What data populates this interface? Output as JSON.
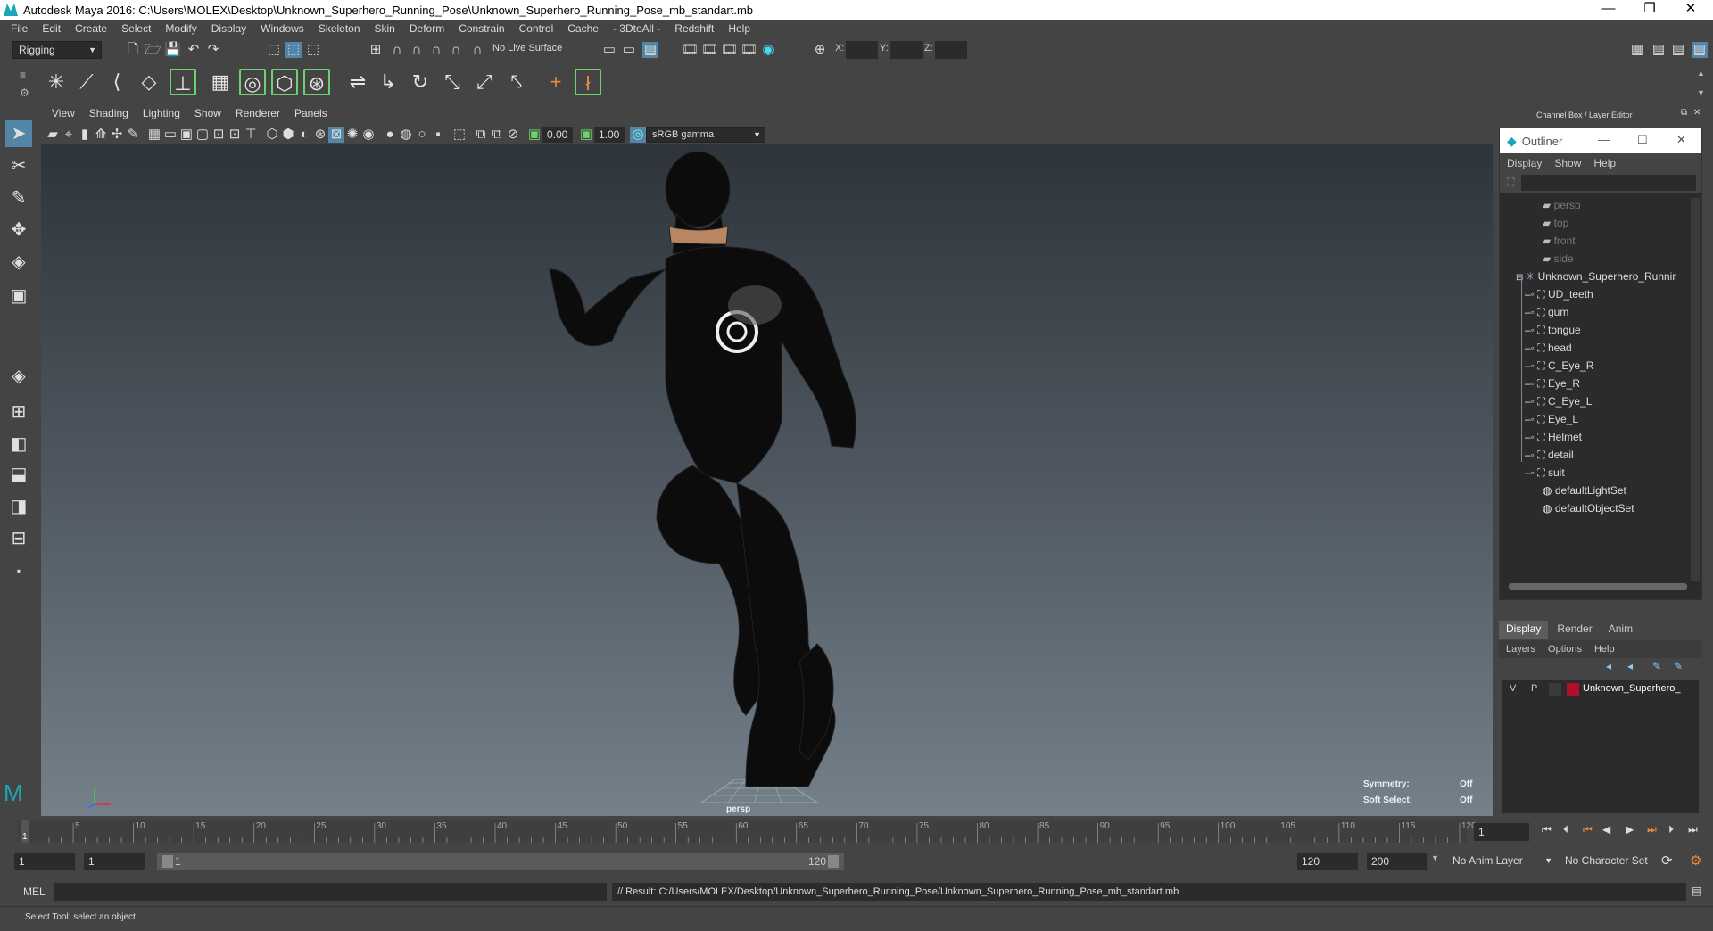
{
  "window": {
    "title": "Autodesk Maya 2016: C:\\Users\\MOLEX\\Desktop\\Unknown_Superhero_Running_Pose\\Unknown_Superhero_Running_Pose_mb_standart.mb"
  },
  "menubar": [
    "File",
    "Edit",
    "Create",
    "Select",
    "Modify",
    "Display",
    "Windows",
    "Skeleton",
    "Skin",
    "Deform",
    "Constrain",
    "Control",
    "Cache",
    "- 3DtoAll -",
    "Redshift",
    "Help"
  ],
  "statusline": {
    "menuset": "Rigging",
    "live_surface": "No Live Surface",
    "x_label": "X:",
    "y_label": "Y:",
    "z_label": "Z:"
  },
  "panel": {
    "menu": [
      "View",
      "Shading",
      "Lighting",
      "Show",
      "Renderer",
      "Panels"
    ],
    "exposure": "0.00",
    "gamma": "1.00",
    "colorspace": "sRGB gamma"
  },
  "viewport": {
    "camera_label": "persp",
    "symmetry_label": "Symmetry:",
    "symmetry_value": "Off",
    "soft_select_label": "Soft Select:",
    "soft_select_value": "Off"
  },
  "right_panel": {
    "header": "Channel Box / Layer Editor"
  },
  "outliner": {
    "title": "Outliner",
    "menu": [
      "Display",
      "Show",
      "Help"
    ],
    "cameras": [
      "persp",
      "top",
      "front",
      "side"
    ],
    "root": "Unknown_Superhero_Runnir",
    "children": [
      "UD_teeth",
      "gum",
      "tongue",
      "head",
      "C_Eye_R",
      "Eye_R",
      "C_Eye_L",
      "Eye_L",
      "Helmet",
      "detail",
      "suit"
    ],
    "sets": [
      "defaultLightSet",
      "defaultObjectSet"
    ]
  },
  "layer_editor": {
    "tabs": [
      "Display",
      "Render",
      "Anim"
    ],
    "menu": [
      "Layers",
      "Options",
      "Help"
    ],
    "layer": {
      "v": "V",
      "p": "P",
      "name": "Unknown_Superhero_",
      "color": "#b0102a"
    }
  },
  "time_slider": {
    "ticks": [
      "1",
      "5",
      "10",
      "15",
      "20",
      "25",
      "30",
      "35",
      "40",
      "45",
      "50",
      "55",
      "60",
      "65",
      "70",
      "75",
      "80",
      "85",
      "90",
      "95",
      "100",
      "105",
      "110",
      "115",
      "120"
    ],
    "current_frame": "1",
    "current_time_field": "1"
  },
  "range_slider": {
    "start": "1",
    "anim_start": "1",
    "range_start": "1",
    "range_end": "120",
    "anim_end_field": "120",
    "end_field": "200",
    "anim_layer": "No Anim Layer",
    "char_set": "No Character Set"
  },
  "command_line": {
    "lang": "MEL",
    "result": "// Result: C:/Users/MOLEX/Desktop/Unknown_Superhero_Running_Pose/Unknown_Superhero_Running_Pose_mb_standart.mb"
  },
  "help_line": "Select Tool: select an object"
}
